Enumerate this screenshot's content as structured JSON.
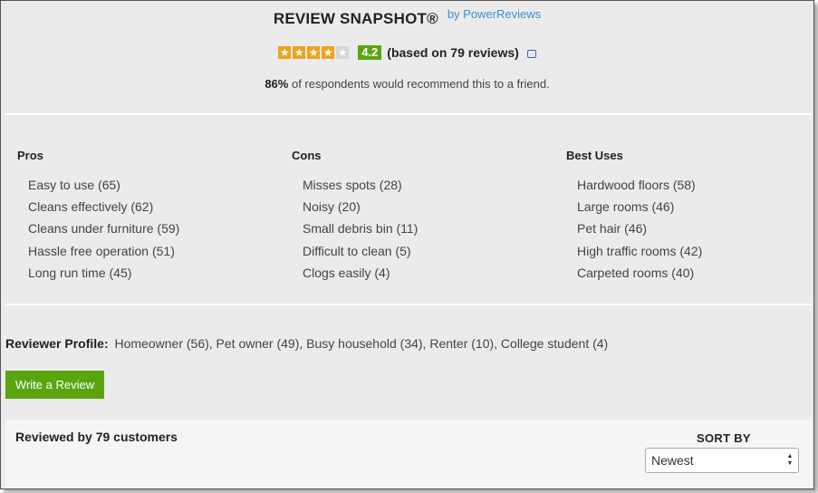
{
  "header": {
    "title": "REVIEW SNAPSHOT®",
    "by_link": "by PowerReviews"
  },
  "rating": {
    "stars_filled": 4,
    "stars_total": 5,
    "value": "4.2",
    "based_on": "(based on 79 reviews)"
  },
  "recommend": {
    "percent": "86%",
    "text": "of respondents would recommend this to a friend."
  },
  "columns": [
    {
      "title": "Pros",
      "items": [
        "Easy to use (65)",
        "Cleans effectively (62)",
        "Cleans under furniture (59)",
        "Hassle free operation (51)",
        "Long run time (45)"
      ]
    },
    {
      "title": "Cons",
      "items": [
        "Misses spots (28)",
        "Noisy (20)",
        "Small debris bin (11)",
        "Difficult to clean (5)",
        "Clogs easily (4)"
      ]
    },
    {
      "title": "Best Uses",
      "items": [
        "Hardwood floors (58)",
        "Large rooms (46)",
        "Pet hair (46)",
        "High traffic rooms (42)",
        "Carpeted rooms (40)"
      ]
    }
  ],
  "profile": {
    "label": "Reviewer Profile:",
    "value": "Homeowner (56), Pet owner (49), Busy household (34), Renter (10), College student (4)"
  },
  "write_review_label": "Write a Review",
  "reviews": {
    "reviewed_by": "Reviewed by 79 customers",
    "sort_label": "SORT BY",
    "sort_value": "Newest"
  },
  "colors": {
    "star": "#f0a21e",
    "accent_green": "#5aa50f",
    "link_blue": "#3a8fd6"
  }
}
